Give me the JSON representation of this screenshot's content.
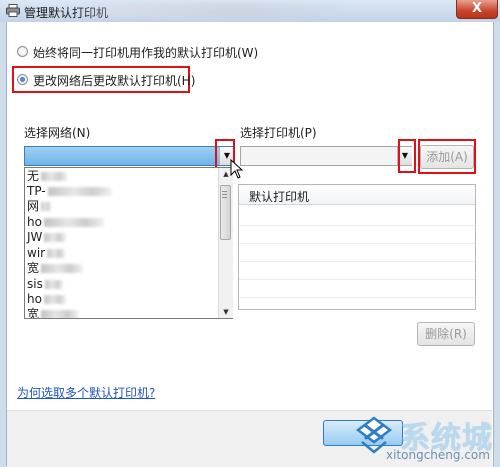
{
  "window": {
    "title": "管理默认打印机",
    "close_glyph": "X"
  },
  "mode": {
    "option_always": "始终将同一打印机用作我的默认打印机(W)",
    "option_change": "更改网络后更改默认打印机(H)",
    "selected": "option_change"
  },
  "network": {
    "label": "选择网络(N)",
    "value": "",
    "items": [
      "无",
      "TP-",
      "网",
      "ho",
      "JW",
      "wir",
      "宽",
      "sis",
      "ho",
      "宽"
    ]
  },
  "printer": {
    "label": "选择打印机(P)",
    "value": "",
    "add_label": "添加(A)"
  },
  "table": {
    "header": "默认打印机",
    "rows": []
  },
  "remove_label": "删除(R)",
  "help_link": "为何选取多个默认打印机?",
  "watermark": {
    "text": "系统城",
    "url": "xitongcheng.com"
  },
  "icons": [
    "printer-icon",
    "close-icon",
    "dropdown-arrow-icon",
    "scroll-up-icon",
    "scroll-down-icon",
    "mouse-cursor-icon",
    "watermark-logo-icon"
  ],
  "colors": {
    "highlight_red": "#e0101a",
    "selection_blue": "#6db4ea",
    "link_blue": "#2056c2"
  }
}
